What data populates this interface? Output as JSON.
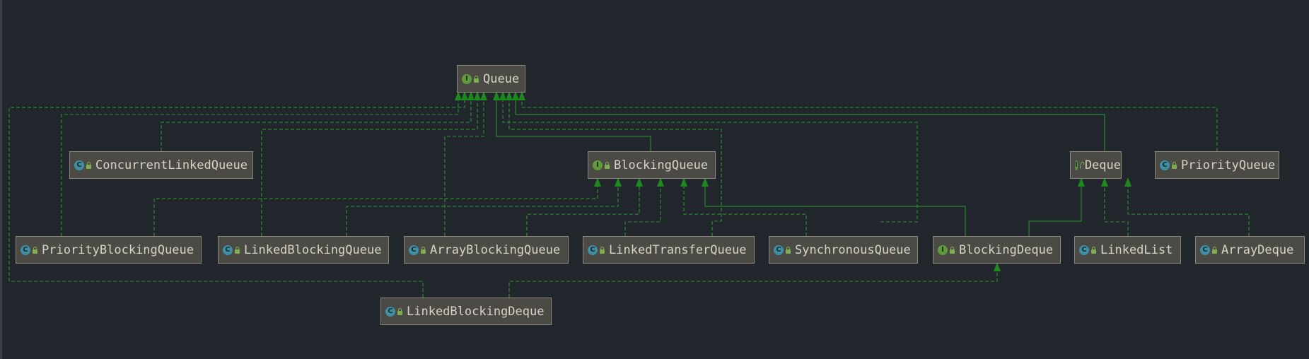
{
  "nodes": [
    {
      "id": "queue",
      "label": "Queue",
      "kind": "interface",
      "kind_letter": "I"
    },
    {
      "id": "concurrent-linked-queue",
      "label": "ConcurrentLinkedQueue",
      "kind": "class",
      "kind_letter": "C"
    },
    {
      "id": "blocking-queue",
      "label": "BlockingQueue",
      "kind": "interface",
      "kind_letter": "I"
    },
    {
      "id": "deque",
      "label": "Deque",
      "kind": "interface",
      "kind_letter": "I"
    },
    {
      "id": "priority-queue",
      "label": "PriorityQueue",
      "kind": "class",
      "kind_letter": "C"
    },
    {
      "id": "priority-blocking-queue",
      "label": "PriorityBlockingQueue",
      "kind": "class",
      "kind_letter": "C"
    },
    {
      "id": "linked-blocking-queue",
      "label": "LinkedBlockingQueue",
      "kind": "class",
      "kind_letter": "C"
    },
    {
      "id": "array-blocking-queue",
      "label": "ArrayBlockingQueue",
      "kind": "class",
      "kind_letter": "C"
    },
    {
      "id": "linked-transfer-queue",
      "label": "LinkedTransferQueue",
      "kind": "class",
      "kind_letter": "C"
    },
    {
      "id": "synchronous-queue",
      "label": "SynchronousQueue",
      "kind": "class",
      "kind_letter": "C"
    },
    {
      "id": "blocking-deque",
      "label": "BlockingDeque",
      "kind": "interface",
      "kind_letter": "I"
    },
    {
      "id": "linked-list",
      "label": "LinkedList",
      "kind": "class",
      "kind_letter": "C"
    },
    {
      "id": "array-deque",
      "label": "ArrayDeque",
      "kind": "class",
      "kind_letter": "C"
    },
    {
      "id": "linked-blocking-deque",
      "label": "LinkedBlockingDeque",
      "kind": "class",
      "kind_letter": "C"
    }
  ],
  "edges": [
    {
      "from": "concurrent-linked-queue",
      "to": "queue",
      "type": "implements"
    },
    {
      "from": "priority-blocking-queue",
      "to": "queue",
      "type": "implements"
    },
    {
      "from": "linked-blocking-queue",
      "to": "queue",
      "type": "implements"
    },
    {
      "from": "array-blocking-queue",
      "to": "queue",
      "type": "implements"
    },
    {
      "from": "linked-transfer-queue",
      "to": "queue",
      "type": "implements"
    },
    {
      "from": "synchronous-queue",
      "to": "queue",
      "type": "implements"
    },
    {
      "from": "blocking-queue",
      "to": "queue",
      "type": "extends"
    },
    {
      "from": "deque",
      "to": "queue",
      "type": "extends"
    },
    {
      "from": "priority-queue",
      "to": "queue",
      "type": "implements"
    },
    {
      "from": "linked-blocking-deque",
      "to": "queue",
      "type": "implements"
    },
    {
      "from": "priority-blocking-queue",
      "to": "blocking-queue",
      "type": "implements"
    },
    {
      "from": "linked-blocking-queue",
      "to": "blocking-queue",
      "type": "implements"
    },
    {
      "from": "array-blocking-queue",
      "to": "blocking-queue",
      "type": "implements"
    },
    {
      "from": "linked-transfer-queue",
      "to": "blocking-queue",
      "type": "implements"
    },
    {
      "from": "synchronous-queue",
      "to": "blocking-queue",
      "type": "implements"
    },
    {
      "from": "blocking-deque",
      "to": "blocking-queue",
      "type": "extends"
    },
    {
      "from": "blocking-deque",
      "to": "deque",
      "type": "extends"
    },
    {
      "from": "linked-list",
      "to": "deque",
      "type": "implements"
    },
    {
      "from": "array-deque",
      "to": "deque",
      "type": "implements"
    },
    {
      "from": "linked-blocking-deque",
      "to": "blocking-deque",
      "type": "implements"
    }
  ],
  "colors": {
    "background": "#22272e",
    "edge": "#2d9a2d",
    "arrowhead": "#1e8a1e",
    "node_fill": "#4c4a44",
    "node_border": "#8a877d",
    "node_text": "#d6d3c8"
  }
}
